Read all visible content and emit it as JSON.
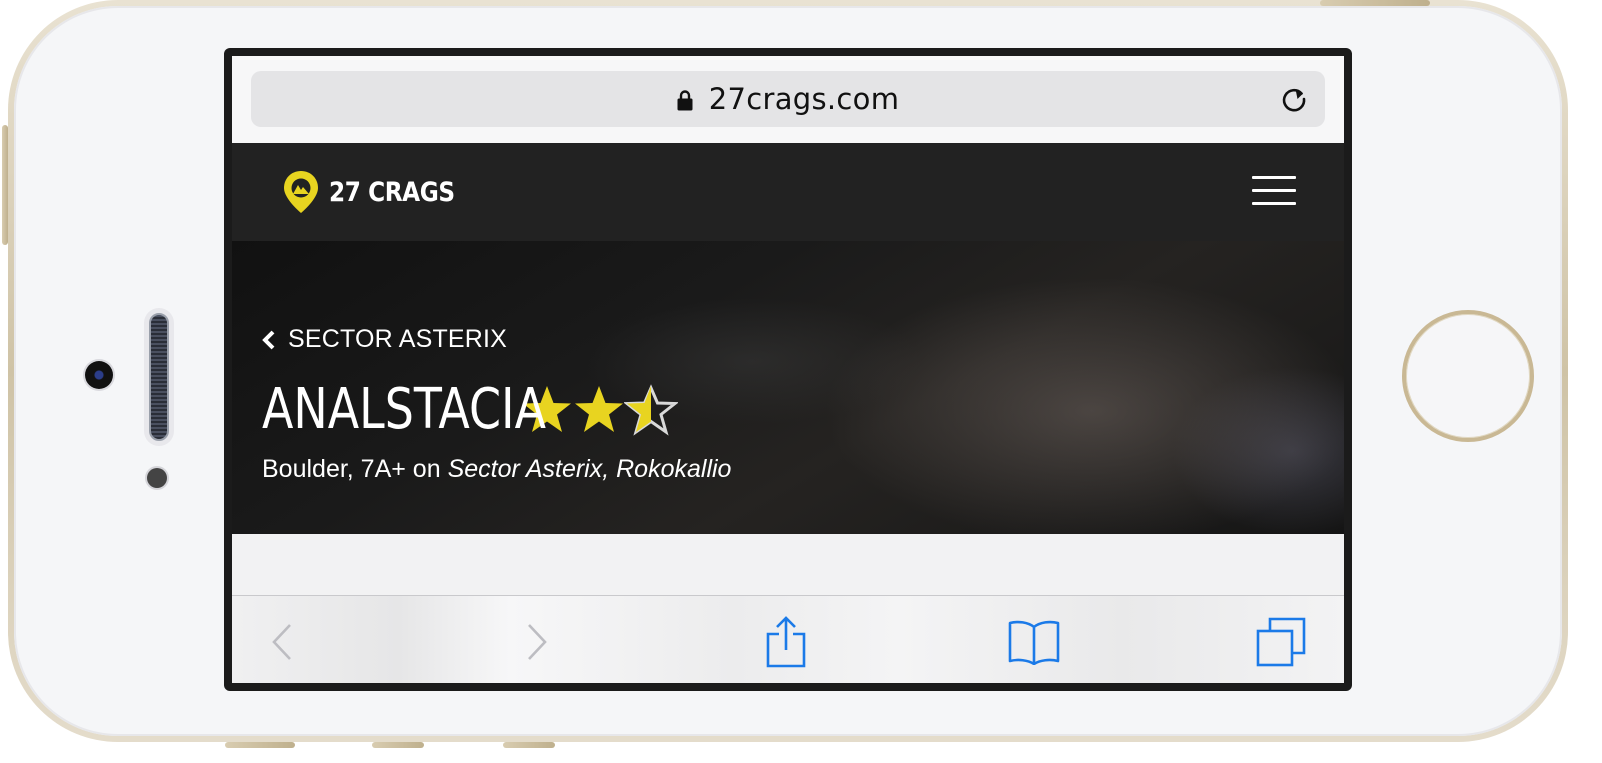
{
  "browser": {
    "url": "27crags.com"
  },
  "site": {
    "logo_text": "27 CRAGS",
    "brand_color": "#e8d420"
  },
  "hero": {
    "back_label": "SECTOR ASTERIX",
    "route_name": "ANALSTACIA",
    "rating": 2.5,
    "rating_max": 3,
    "subtitle_prefix": "Boulder, 7A+ on ",
    "subtitle_location": "Sector Asterix, Rokokallio"
  },
  "toolbar": {
    "icons": [
      "back-icon",
      "forward-icon",
      "share-icon",
      "bookmarks-icon",
      "tabs-icon"
    ],
    "accent": "#1b7ae8"
  }
}
